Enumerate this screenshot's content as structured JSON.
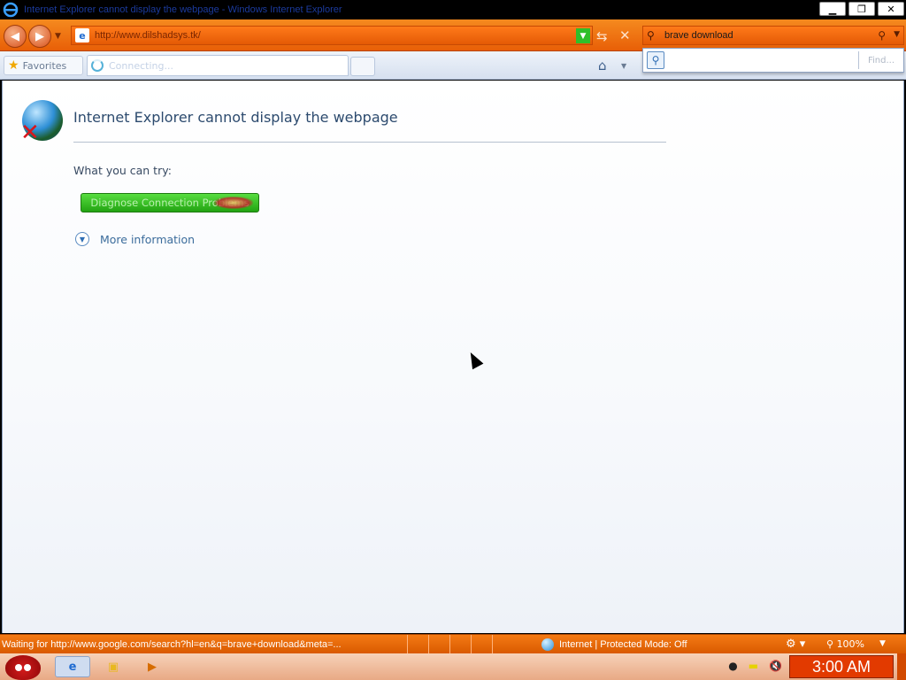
{
  "window": {
    "title": "Internet Explorer cannot display the webpage - Windows Internet Explorer",
    "minimize": "▁",
    "restore": "❐",
    "close": "✕"
  },
  "address_bar": {
    "url": "http://www.dilshadsys.tk/"
  },
  "search": {
    "query": "brave download"
  },
  "command_bar": {
    "favorites_label": "Favorites",
    "tab_title": "Connecting..."
  },
  "find": {
    "button_label": "Find..."
  },
  "error_page": {
    "heading": "Internet Explorer cannot display the webpage",
    "try_label": "What you can try:",
    "diagnose_button": "Diagnose Connection Problems",
    "more_info": "More information"
  },
  "status_bar": {
    "message": "Waiting for http://www.google.com/search?hl=en&q=brave+download&meta=...",
    "zone": "Internet | Protected Mode: Off",
    "zoom": "100%"
  },
  "taskbar": {
    "clock": "3:00 AM"
  },
  "colors": {
    "accent": "#e85f07",
    "diagnose_green": "#22a312",
    "clock_red": "#e23a00"
  }
}
